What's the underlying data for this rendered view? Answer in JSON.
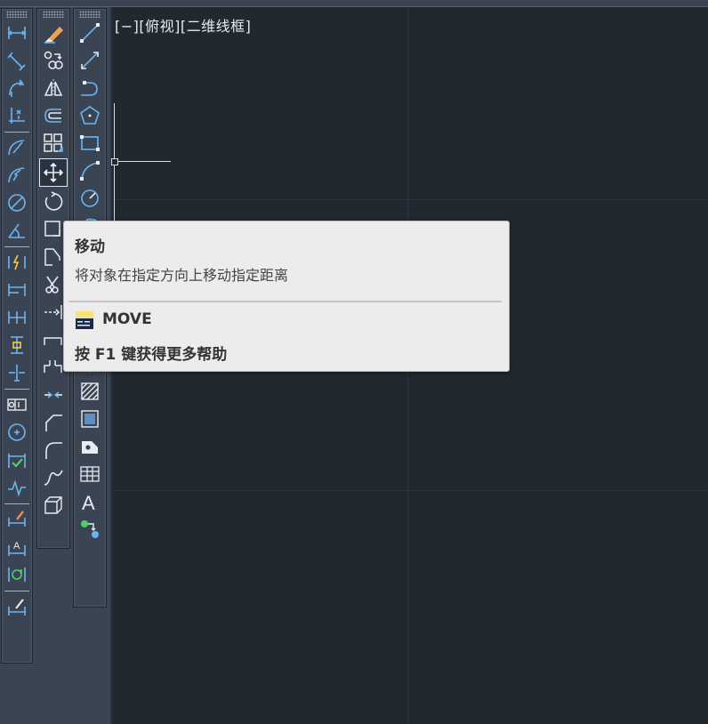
{
  "viewport": {
    "label": "[−][俯视][二维线框]"
  },
  "tooltip": {
    "title": "移动",
    "description": "将对象在指定方向上移动指定距离",
    "command": "MOVE",
    "help": "按 F1 键获得更多帮助"
  },
  "colors": {
    "canvas_bg": "#212830",
    "panel_bg": "#3b4452",
    "icon_blue": "#6cb4f0",
    "icon_white": "#e8ecf0",
    "tooltip_bg": "#ececec"
  },
  "toolbars": {
    "dimension": [
      "linear-dimension-icon",
      "aligned-dimension-icon",
      "arc-length-dimension-icon",
      "ordinate-dimension-icon",
      "radius-dimension-icon",
      "jogged-dimension-icon",
      "diameter-dimension-icon",
      "angular-dimension-icon",
      "quick-dimension-icon",
      "baseline-dimension-icon",
      "continue-dimension-icon",
      "dimension-space-icon",
      "dimension-break-icon",
      "tolerance-icon",
      "center-mark-icon",
      "inspection-icon",
      "jogged-linear-icon",
      "dimension-edit-icon",
      "dimension-text-edit-icon",
      "dimension-update-icon",
      "dimension-style-icon"
    ],
    "modify": [
      "erase-icon",
      "copy-icon",
      "mirror-icon",
      "offset-icon",
      "array-icon",
      "move-icon",
      "rotate-icon",
      "scale-icon",
      "stretch-icon",
      "trim-icon",
      "extend-icon",
      "break-at-point-icon",
      "break-icon",
      "join-icon",
      "chamfer-icon",
      "fillet-icon",
      "blend-curves-icon",
      "explode-icon"
    ],
    "draw": [
      "line-icon",
      "construction-line-icon",
      "polyline-icon",
      "polygon-icon",
      "rectangle-icon",
      "arc-icon",
      "circle-icon",
      "revision-cloud-icon",
      "spline-icon",
      "ellipse-icon",
      "ellipse-arc-icon",
      "insert-block-icon",
      "make-block-icon",
      "point-icon",
      "hatch-icon",
      "gradient-icon",
      "region-icon",
      "table-icon",
      "multiline-text-icon",
      "add-selected-icon"
    ]
  }
}
